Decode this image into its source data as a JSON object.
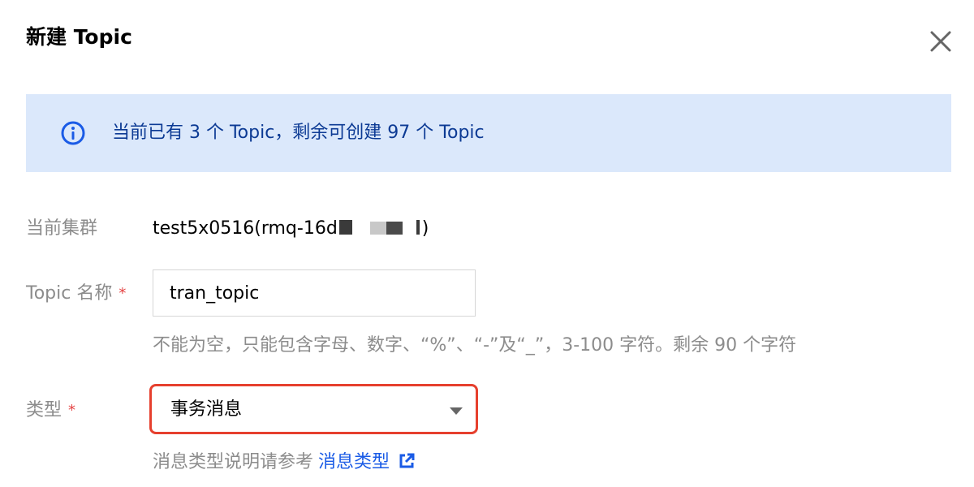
{
  "dialog": {
    "title": "新建 Topic"
  },
  "banner": {
    "text": "当前已有 3 个 Topic，剩余可创建 97 个 Topic",
    "color": "#0c3a94",
    "background": "#dbe8fb"
  },
  "form": {
    "cluster": {
      "label": "当前集群",
      "value_prefix": "test5x0516(rmq-16d",
      "value_suffix": ")"
    },
    "topic_name": {
      "label": "Topic 名称",
      "required_mark": "*",
      "value": "tran_topic",
      "hint": "不能为空，只能包含字母、数字、“%”、“-”及“_”，3-100 字符。剩余 90 个字符"
    },
    "type": {
      "label": "类型",
      "required_mark": "*",
      "selected": "事务消息",
      "help_text": "消息类型说明请参考",
      "help_link": "消息类型"
    }
  },
  "colors": {
    "accent": "#1a5be6",
    "required": "#e54545",
    "highlight_border": "#e6402e",
    "muted_text": "#8c8c8c"
  },
  "icons": {
    "close": "close-icon",
    "info": "info-icon",
    "dropdown": "caret-down-icon",
    "external": "external-link-icon"
  }
}
